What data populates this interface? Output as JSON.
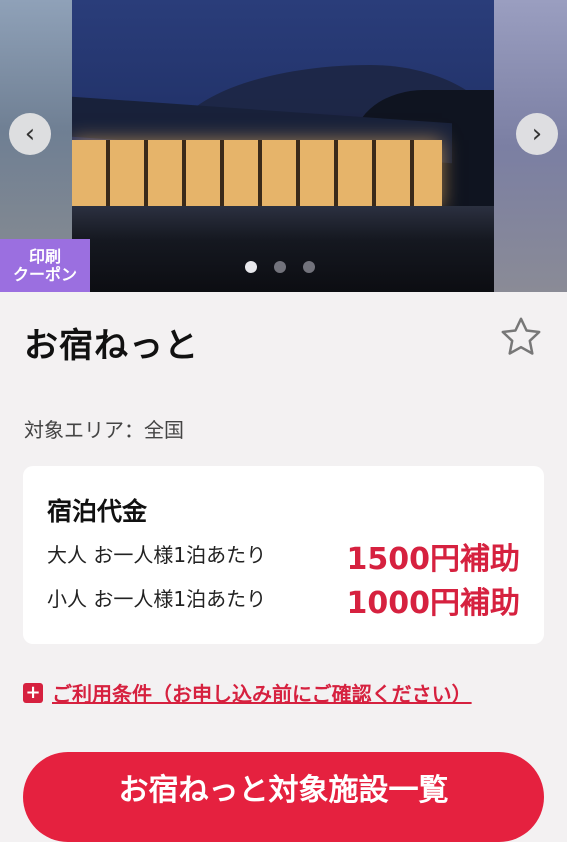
{
  "carousel": {
    "prev_icon": "chevron-left-icon",
    "next_icon": "chevron-right-icon",
    "prev_glyph": "‹",
    "next_glyph": "›",
    "badge_line1": "印刷",
    "badge_line2": "クーポン",
    "slide_count": 3,
    "active_slide": 1
  },
  "title": "お宿ねっと",
  "favorite_icon": "star-outline-icon",
  "area": "対象エリア：全国",
  "card": {
    "title": "宿泊代金",
    "rows": [
      {
        "label": "大人 お一人様1泊あたり",
        "value": "1500円補助"
      },
      {
        "label": "小人 お一人様1泊あたり",
        "value": "1000円補助"
      }
    ]
  },
  "conditions": {
    "icon": "plus-icon",
    "glyph": "+",
    "text": "ご利用条件（お申し込み前にご確認ください）"
  },
  "cta_label": "お宿ねっと対象施設一覧",
  "colors": {
    "accent": "#d6213f",
    "badge": "#9b6fe0",
    "background": "#f3f1f2"
  }
}
